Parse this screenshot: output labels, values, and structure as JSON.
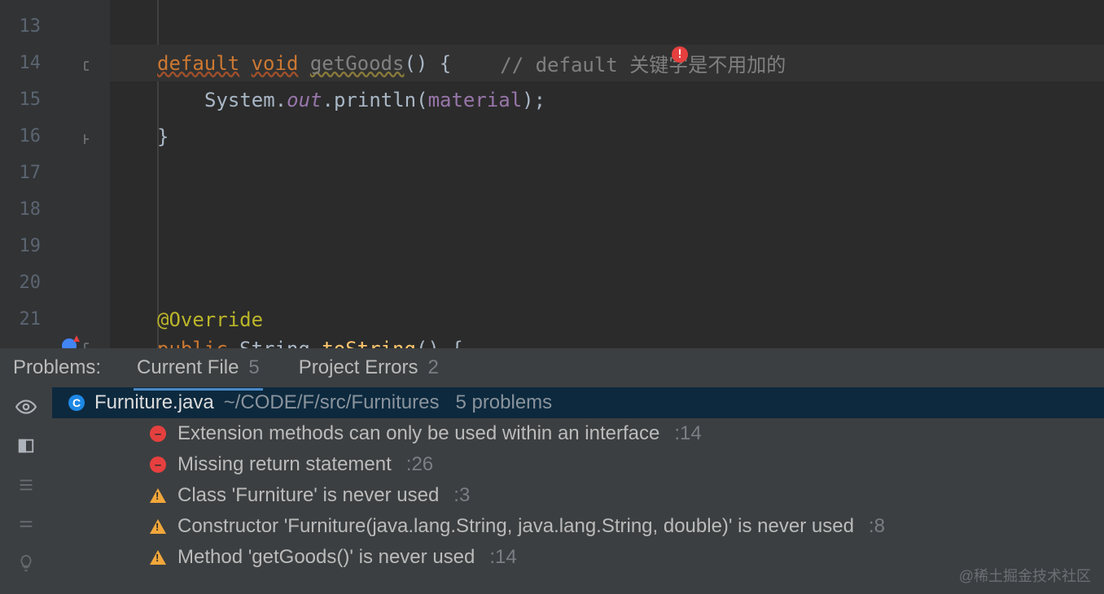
{
  "gutter": {
    "lines": [
      "13",
      "14",
      "15",
      "16",
      "17",
      "18",
      "19",
      "20",
      "21"
    ]
  },
  "code": {
    "line14": {
      "kw1": "default",
      "kw2": "void",
      "method": "getGoods",
      "tail": "() {",
      "comment": "// default 关键字是不用加的"
    },
    "line15": {
      "pre": "System.",
      "out": "out",
      "dot": ".",
      "println": "println",
      "open": "(",
      "arg": "material",
      "close": ");"
    },
    "line16": {
      "brace": "}"
    },
    "line21": {
      "anno": "@Override"
    },
    "line22": {
      "kw": "public",
      "cls": "String",
      "method": "toString",
      "tail": "() {"
    }
  },
  "problems": {
    "title": "Problems:",
    "tabs": {
      "current": {
        "label": "Current File",
        "count": "5"
      },
      "project": {
        "label": "Project Errors",
        "count": "2"
      }
    },
    "file": {
      "badge": "C",
      "name": "Furniture.java",
      "path": "~/CODE/F/src/Furnitures",
      "count": "5 problems"
    },
    "items": [
      {
        "sev": "error",
        "msg": "Extension methods can only be used within an interface",
        "line": ":14"
      },
      {
        "sev": "error",
        "msg": "Missing return statement",
        "line": ":26"
      },
      {
        "sev": "warn",
        "msg": "Class 'Furniture' is never used",
        "line": ":3"
      },
      {
        "sev": "warn",
        "msg": "Constructor 'Furniture(java.lang.String, java.lang.String, double)' is never used",
        "line": ":8"
      },
      {
        "sev": "warn",
        "msg": "Method 'getGoods()' is never used",
        "line": ":14"
      }
    ]
  },
  "watermark": "@稀土掘金技术社区"
}
